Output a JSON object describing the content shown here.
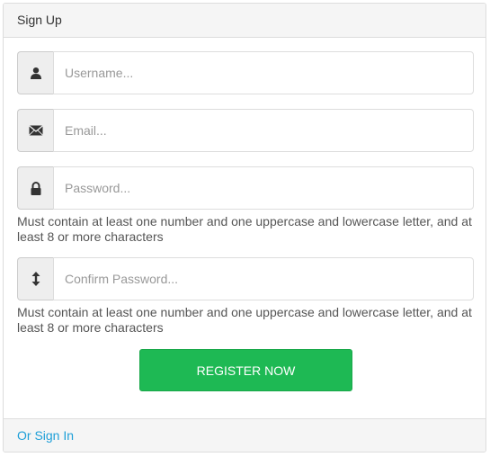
{
  "panel": {
    "title": "Sign Up"
  },
  "form": {
    "username": {
      "placeholder": "Username...",
      "value": "",
      "icon": "user-icon"
    },
    "email": {
      "placeholder": "Email...",
      "value": "",
      "icon": "envelope-icon"
    },
    "password": {
      "placeholder": "Password...",
      "value": "",
      "icon": "lock-icon",
      "help": "Must contain at least one number and one uppercase and lowercase letter, and at least 8 or more characters"
    },
    "confirm_password": {
      "placeholder": "Confirm Password...",
      "value": "",
      "icon": "vertical-arrows-icon",
      "help": "Must contain at least one number and one uppercase and lowercase letter, and at least 8 or more characters"
    },
    "submit_label": "REGISTER NOW"
  },
  "footer": {
    "link_label": "Or Sign In"
  },
  "colors": {
    "accent_button": "#1eb954",
    "link": "#1e9fd8",
    "panel_header_bg": "#f5f5f5"
  }
}
